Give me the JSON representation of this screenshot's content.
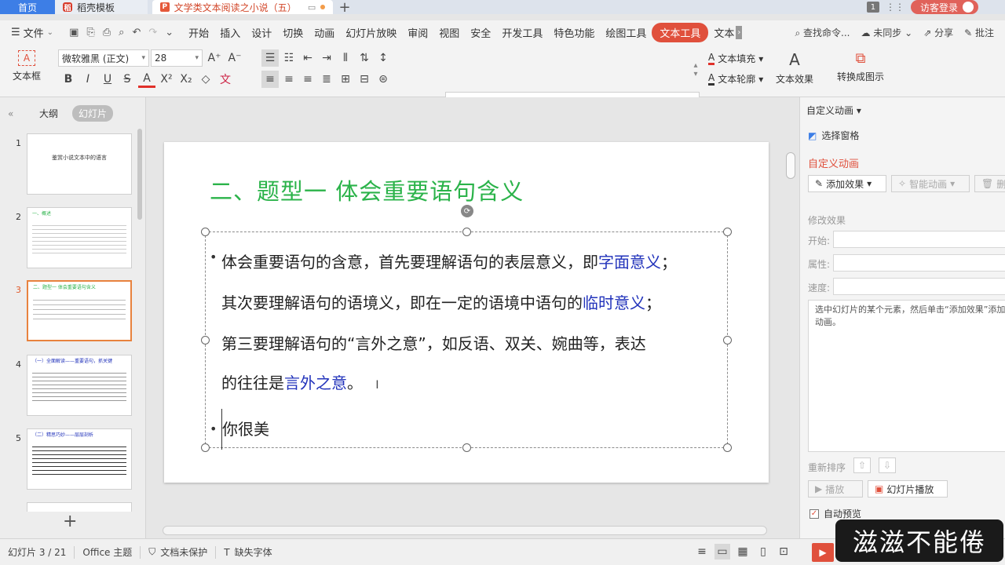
{
  "tabs": {
    "home": "首页",
    "template": "稻壳模板",
    "document": "文学类文本阅读之小说（五）",
    "visitor": "访客登录",
    "counter": "1"
  },
  "menu": {
    "file": "文件",
    "items": [
      "开始",
      "插入",
      "设计",
      "切换",
      "动画",
      "幻灯片放映",
      "审阅",
      "视图",
      "安全",
      "开发工具",
      "特色功能",
      "绘图工具",
      "文本工具",
      "文本"
    ],
    "active_index": 12,
    "search": "查找命令...",
    "sync": "未同步",
    "share": "分享",
    "comment": "批注"
  },
  "ribbon": {
    "textbox": "文本框",
    "font_name": "微软雅黑 (正文)",
    "font_size": "28",
    "text_fill": "文本填充",
    "text_outline": "文本轮廓",
    "text_effect": "文本效果",
    "convert_smartart": "转换成图示",
    "style_letter": "A",
    "style_colors": [
      "#111111",
      "#3d8ee0",
      "#e8823e",
      "#5a86c9",
      "#f2c40f",
      "#555555"
    ]
  },
  "left_panel": {
    "outline_tab": "大纲",
    "slides_tab": "幻灯片",
    "thumbnails": [
      {
        "num": "1",
        "text": "鉴赏小说文本中的语言"
      },
      {
        "num": "2",
        "text": "一、概述"
      },
      {
        "num": "3",
        "text": "二、题型一 体会重要语句含义"
      },
      {
        "num": "4",
        "text": "（一）全面解读——重要语句，抓关键"
      },
      {
        "num": "5",
        "text": "（二）精思巧妙——层层剖析"
      }
    ],
    "current_index": 2
  },
  "slide": {
    "title": "二、题型一 体会重要语句含义",
    "p1_a": "体会重要语句的含意，首先要理解语句的表层意义，即",
    "p1_b": "字面意义",
    "p1_c": "；",
    "p2_a": "其次要理解语句的语境义，即在一定的语境中语句的",
    "p2_b": "临时意义",
    "p2_c": "；",
    "p3": "第三要理解语句的“言外之意”，如反语、双关、婉曲等，表达",
    "p4_a": "的往往是",
    "p4_b": "言外之意",
    "p4_c": "。",
    "p5": "你很美",
    "bullet": "•"
  },
  "right_panel": {
    "header": "自定义动画",
    "select_pane": "选择窗格",
    "section": "自定义动画",
    "add_effect": "添加效果",
    "smart_anim": "智能动画",
    "delete": "删",
    "modify": "修改效果",
    "start_label": "开始:",
    "prop_label": "属性:",
    "speed_label": "速度:",
    "hint": "选中幻灯片的某个元素，然后单击“添加效果”添加动画。",
    "reorder": "重新排序",
    "play": "播放",
    "slideshow": "幻灯片播放",
    "autopreview": "自动预览"
  },
  "status": {
    "slide_info": "幻灯片 3 / 21",
    "theme": "Office 主题",
    "protect": "文档未保护",
    "missing_font": "缺失字体"
  },
  "watermark": "滋滋不能倦"
}
